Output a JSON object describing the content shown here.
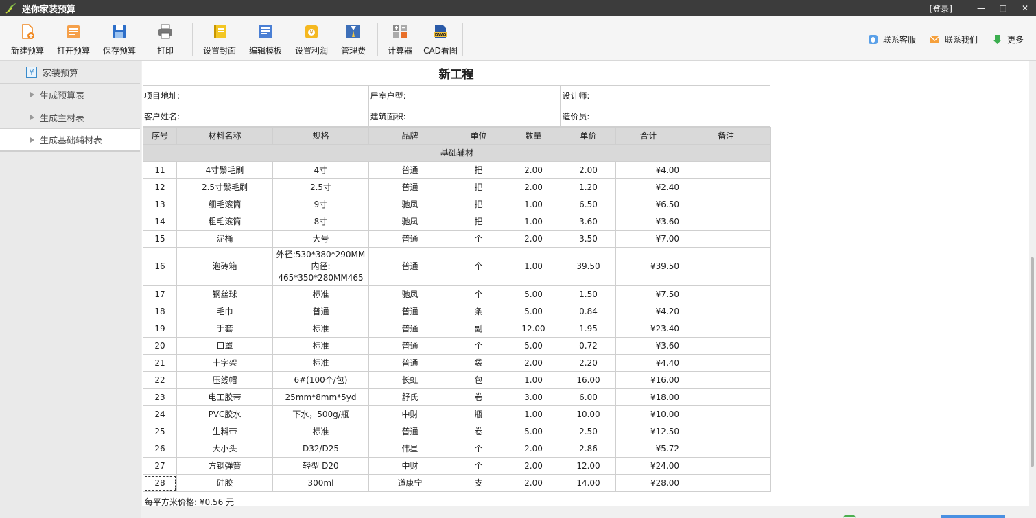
{
  "app": {
    "title": "迷你家装预算",
    "login": "[登录]"
  },
  "window": {
    "minimize": "—",
    "maximize": "□",
    "close": "✕"
  },
  "toolbar": {
    "items": [
      {
        "label": "新建预算",
        "icon": "new-doc-icon"
      },
      {
        "label": "打开预算",
        "icon": "open-doc-icon"
      },
      {
        "label": "保存预算",
        "icon": "save-icon"
      },
      {
        "label": "打印",
        "icon": "print-icon"
      },
      {
        "label": "设置封面",
        "icon": "cover-icon"
      },
      {
        "label": "编辑模板",
        "icon": "edit-template-icon"
      },
      {
        "label": "设置利润",
        "icon": "profit-icon"
      },
      {
        "label": "管理费",
        "icon": "management-fee-icon"
      },
      {
        "label": "计算器",
        "icon": "calculator-icon"
      },
      {
        "label": "CAD看图",
        "icon": "cad-icon"
      }
    ],
    "right": [
      {
        "label": "联系客服",
        "icon": "qq-icon"
      },
      {
        "label": "联系我们",
        "icon": "mail-icon"
      },
      {
        "label": "更多",
        "icon": "download-arrow-icon"
      }
    ]
  },
  "sidebar": {
    "root": "家装预算",
    "items": [
      "生成预算表",
      "生成主材表",
      "生成基础辅材表"
    ]
  },
  "sheet": {
    "title": "新工程",
    "info": {
      "address": "项目地址:",
      "layout": "居室户型:",
      "designer": "设计师:",
      "customer": "客户姓名:",
      "area": "建筑面积:",
      "estimator": "造价员:"
    },
    "headers": [
      "序号",
      "材料名称",
      "规格",
      "品牌",
      "单位",
      "数量",
      "单价",
      "合计",
      "备注"
    ],
    "section": "基础辅材",
    "rows": [
      [
        "11",
        "4寸鬃毛刷",
        "4寸",
        "普通",
        "把",
        "2.00",
        "2.00",
        "¥4.00",
        ""
      ],
      [
        "12",
        "2.5寸鬃毛刷",
        "2.5寸",
        "普通",
        "把",
        "2.00",
        "1.20",
        "¥2.40",
        ""
      ],
      [
        "13",
        "细毛滚筒",
        "9寸",
        "驰凤",
        "把",
        "1.00",
        "6.50",
        "¥6.50",
        ""
      ],
      [
        "14",
        "粗毛滚筒",
        "8寸",
        "驰凤",
        "把",
        "1.00",
        "3.60",
        "¥3.60",
        ""
      ],
      [
        "15",
        "泥桶",
        "大号",
        "普通",
        "个",
        "2.00",
        "3.50",
        "¥7.00",
        ""
      ],
      [
        "16",
        "泡砖箱",
        "外径:530*380*290MM 内径: 465*350*280MM465",
        "普通",
        "个",
        "1.00",
        "39.50",
        "¥39.50",
        ""
      ],
      [
        "17",
        "钢丝球",
        "标准",
        "驰凤",
        "个",
        "5.00",
        "1.50",
        "¥7.50",
        ""
      ],
      [
        "18",
        "毛巾",
        "普通",
        "普通",
        "条",
        "5.00",
        "0.84",
        "¥4.20",
        ""
      ],
      [
        "19",
        "手套",
        "标准",
        "普通",
        "副",
        "12.00",
        "1.95",
        "¥23.40",
        ""
      ],
      [
        "20",
        "口罩",
        "标准",
        "普通",
        "个",
        "5.00",
        "0.72",
        "¥3.60",
        ""
      ],
      [
        "21",
        "十字架",
        "标准",
        "普通",
        "袋",
        "2.00",
        "2.20",
        "¥4.40",
        ""
      ],
      [
        "22",
        "压线帽",
        "6#(100个/包)",
        "长虹",
        "包",
        "1.00",
        "16.00",
        "¥16.00",
        ""
      ],
      [
        "23",
        "电工胶带",
        "25mm*8mm*5yd",
        "舒氏",
        "卷",
        "3.00",
        "6.00",
        "¥18.00",
        ""
      ],
      [
        "24",
        "PVC胶水",
        "下水，500g/瓶",
        "中财",
        "瓶",
        "1.00",
        "10.00",
        "¥10.00",
        ""
      ],
      [
        "25",
        "生料带",
        "标准",
        "普通",
        "卷",
        "5.00",
        "2.50",
        "¥12.50",
        ""
      ],
      [
        "26",
        "大小头",
        "D32/D25",
        "伟星",
        "个",
        "2.00",
        "2.86",
        "¥5.72",
        ""
      ],
      [
        "27",
        "方钢弹簧",
        "轻型 D20",
        "中财",
        "个",
        "2.00",
        "12.00",
        "¥24.00",
        ""
      ],
      [
        "28",
        "硅胶",
        "300ml",
        "道康宁",
        "支",
        "2.00",
        "14.00",
        "¥28.00",
        ""
      ]
    ],
    "footer": "每平方米价格: ¥0.56 元"
  }
}
